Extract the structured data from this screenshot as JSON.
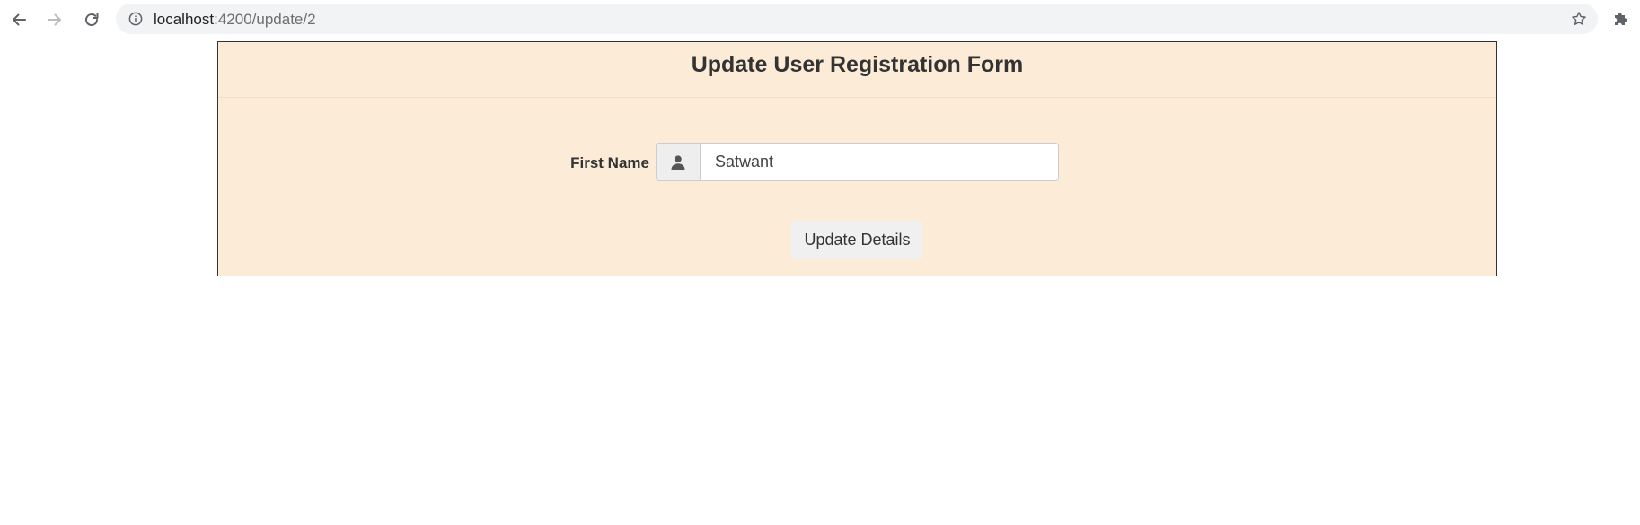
{
  "browser": {
    "url_host": "localhost",
    "url_path": ":4200/update/2",
    "icons": {
      "back": "arrow-left-icon",
      "forward": "arrow-right-icon",
      "reload": "reload-icon",
      "site_info": "info-icon",
      "bookmark": "star-icon",
      "extensions": "puzzle-icon"
    }
  },
  "form": {
    "title": "Update User Registration Form",
    "fields": [
      {
        "label": "First Name",
        "value": "Satwant",
        "icon": "user-icon"
      }
    ],
    "submit_label": "Update Details"
  },
  "colors": {
    "panel_background": "#fbebd7",
    "panel_border": "#333333",
    "button_background": "#f0f0f0"
  }
}
